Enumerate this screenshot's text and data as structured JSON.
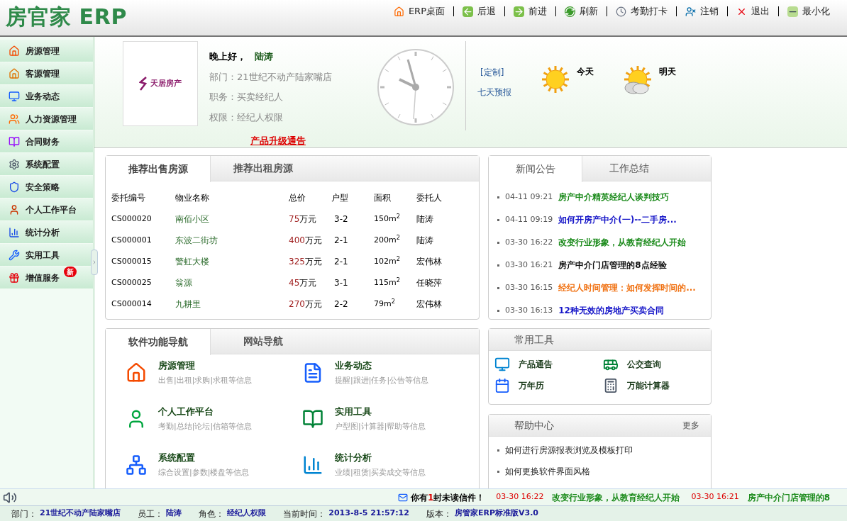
{
  "app": {
    "logo": "房官家 ERP"
  },
  "toolbar": [
    {
      "label": "ERP桌面"
    },
    {
      "label": "后退"
    },
    {
      "label": "前进"
    },
    {
      "label": "刷新"
    },
    {
      "label": "考勤打卡"
    },
    {
      "label": "注销"
    },
    {
      "label": "退出"
    },
    {
      "label": "最小化"
    }
  ],
  "sidebar": {
    "items": [
      {
        "label": "房源管理"
      },
      {
        "label": "客源管理"
      },
      {
        "label": "业务动态"
      },
      {
        "label": "人力资源管理"
      },
      {
        "label": "合同财务"
      },
      {
        "label": "系统配置"
      },
      {
        "label": "安全策略"
      },
      {
        "label": "个人工作平台"
      },
      {
        "label": "统计分析"
      },
      {
        "label": "实用工具"
      },
      {
        "label": "增值服务",
        "badge": "新"
      }
    ]
  },
  "profile": {
    "company_logo": "天居房产",
    "greeting": "晚上好，",
    "name": "陆涛",
    "lines": [
      "部门：21世纪不动产陆家嘴店",
      "职务：买卖经纪人",
      "权限：经纪人权限"
    ],
    "notice_link": "产品升级通告"
  },
  "weather": {
    "customize": "[定制]",
    "forecast_link": "七天预报",
    "days": [
      {
        "label": "今天",
        "kind": "sunny"
      },
      {
        "label": "明天",
        "kind": "cloudy"
      }
    ]
  },
  "listings": {
    "tabs": [
      {
        "label": "推荐出售房源",
        "selected": true
      },
      {
        "label": "推荐出租房源",
        "selected": false
      }
    ],
    "columns": [
      "委托编号",
      "物业名称",
      "总价",
      "户型",
      "面积",
      "委托人"
    ],
    "rows": [
      {
        "id": "CS000020",
        "name": "南佰小区",
        "price": "75",
        "price_unit": "万元",
        "layout": "3-2",
        "area": "150m$^{2}$",
        "agent": "陆涛"
      },
      {
        "id": "CS000001",
        "name": "东波二街坊",
        "price": "400",
        "price_unit": "万元",
        "layout": "2-1",
        "area": "200m$^{2}$",
        "agent": "陆涛"
      },
      {
        "id": "CS000015",
        "name": "警虹大楼",
        "price": "325",
        "price_unit": "万元",
        "layout": "2-1",
        "area": "102m$^{2}$",
        "agent": "宏伟林"
      },
      {
        "id": "CS000025",
        "name": "翁源",
        "price": "45",
        "price_unit": "万元",
        "layout": "3-1",
        "area": "115m$^{2}$",
        "agent": "任晓萍"
      },
      {
        "id": "CS000014",
        "name": "九耕里",
        "price": "270",
        "price_unit": "万元",
        "layout": "2-2",
        "area": "79m$^{2}$",
        "agent": "宏伟林"
      }
    ]
  },
  "news": {
    "tabs": [
      {
        "label": "新闻公告",
        "selected": true
      },
      {
        "label": "工作总结",
        "selected": false
      }
    ],
    "items": [
      {
        "time": "04-11 09:21",
        "title": "房产中介精英经纪人谈判技巧",
        "color": "#1a8a1a"
      },
      {
        "time": "04-11 09:19",
        "title": "如何开房产中介(一)--二手房...",
        "color": "#1515c8"
      },
      {
        "time": "03-30 16:22",
        "title": "改变行业形象，从教育经纪人开始",
        "color": "#1a8a1a"
      },
      {
        "time": "03-30 16:21",
        "title": "房产中介门店管理的8点经验",
        "color": "#111111"
      },
      {
        "time": "03-30 16:15",
        "title": "经纪人时间管理：如何发挥时间的...",
        "color": "#f07010"
      },
      {
        "time": "03-30 16:13",
        "title": "12种无效的房地产买卖合同",
        "color": "#1515c8"
      }
    ]
  },
  "navigation": {
    "tabs": [
      {
        "label": "软件功能导航",
        "selected": true
      },
      {
        "label": "网站导航",
        "selected": false
      }
    ],
    "items": [
      {
        "title": "房源管理",
        "subtitle": "出售|出租|求购|求租等信息"
      },
      {
        "title": "业务动态",
        "subtitle": "提醒|跟进|任务|公告等信息"
      },
      {
        "title": "个人工作平台",
        "subtitle": "考勤|总结|论坛|信箱等信息"
      },
      {
        "title": "实用工具",
        "subtitle": "户型图|计算器|帮助等信息"
      },
      {
        "title": "系统配置",
        "subtitle": "综合设置|参数|楼盘等信息"
      },
      {
        "title": "统计分析",
        "subtitle": "业绩|租赁|买卖成交等信息"
      }
    ]
  },
  "tools": {
    "title": "常用工具",
    "items": [
      "产品通告",
      "公交查询",
      "万年历",
      "万能计算器"
    ]
  },
  "help": {
    "title": "帮助中心",
    "more": "更多",
    "items": [
      "如何进行房源报表浏览及模板打印",
      "如何更换软件界面风格"
    ]
  },
  "ticker": {
    "mail_prefix": "你有",
    "mail_count": "1",
    "mail_suffix": "封未读信件！",
    "items": [
      {
        "time": "03-30 16:22",
        "title": "改变行业形象，从教育经纪人开始"
      },
      {
        "time": "03-30 16:21",
        "title": "房产中介门店管理的8"
      }
    ]
  },
  "status_bar": [
    {
      "label": "部门：",
      "value": "21世纪不动产陆家嘴店"
    },
    {
      "label": "员工：",
      "value": "陆涛"
    },
    {
      "label": "角色：",
      "value": "经纪人权限"
    },
    {
      "label": "当前时间：",
      "value": "2013-8-5 21:57:12"
    },
    {
      "label": "版本：",
      "value": "房管家ERP标准版V3.0"
    }
  ]
}
